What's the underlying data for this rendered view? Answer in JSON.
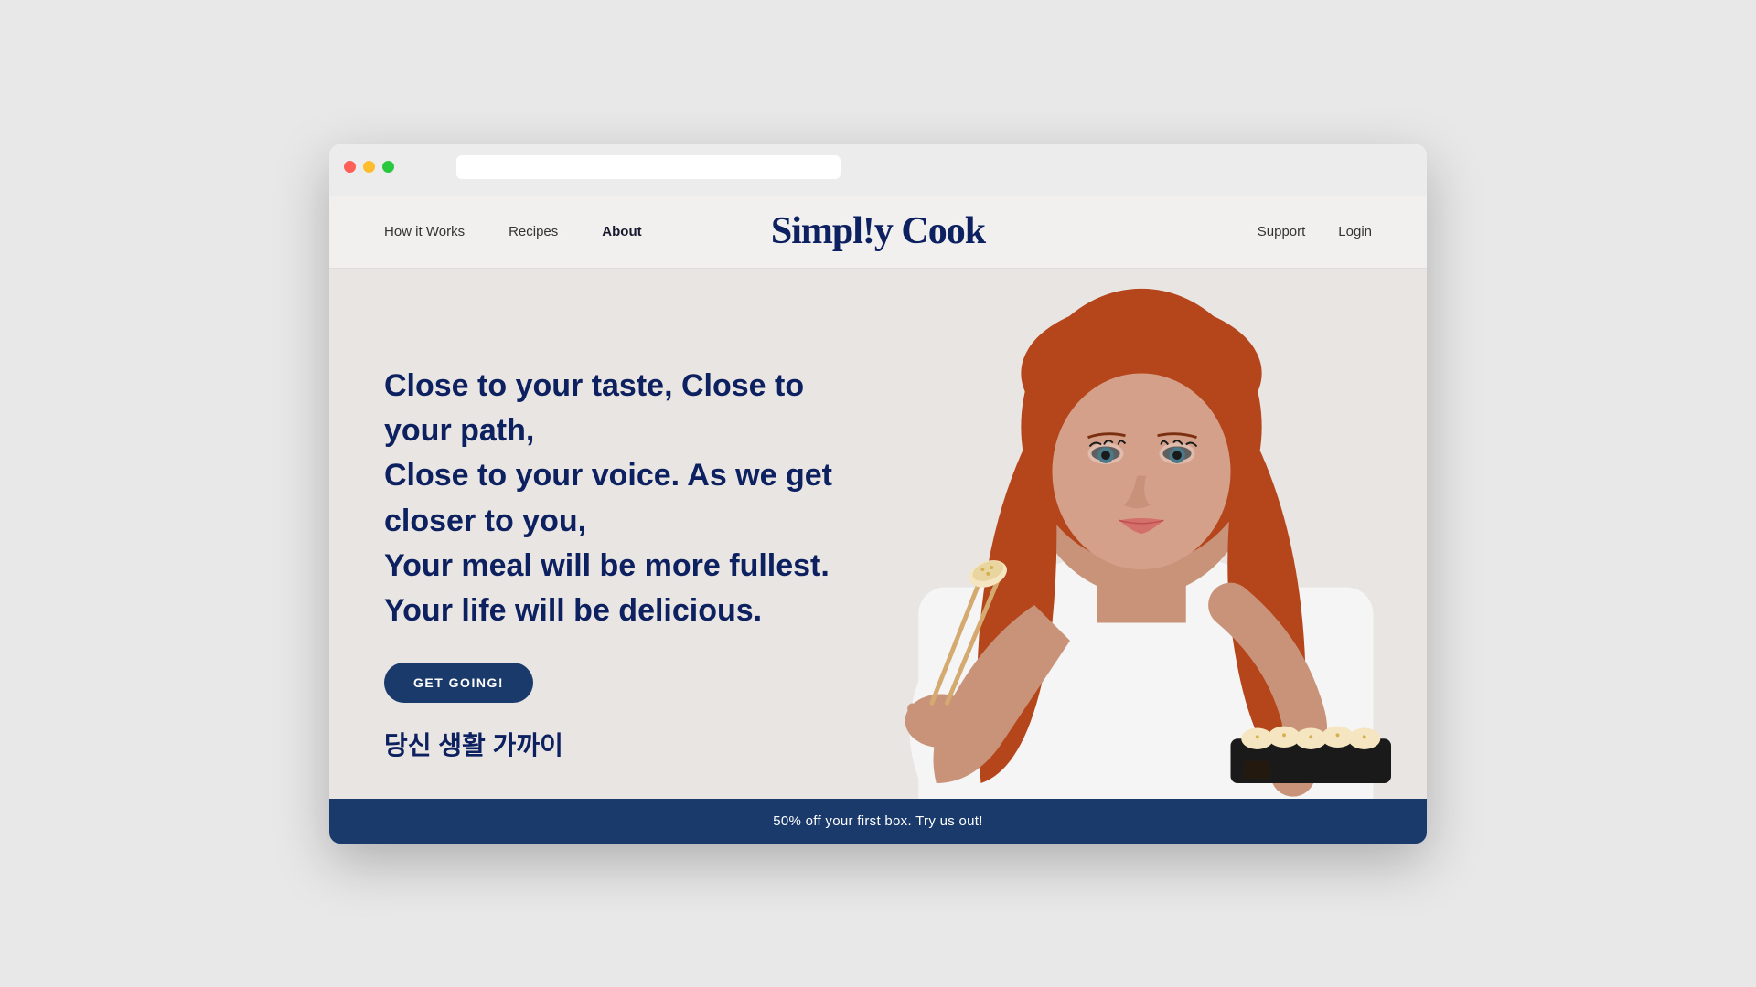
{
  "browser": {
    "dots": [
      "red",
      "yellow",
      "green"
    ]
  },
  "navbar": {
    "logo": "Simpl!y Cook",
    "nav_left": [
      {
        "label": "How it Works",
        "active": false
      },
      {
        "label": "Recipes",
        "active": false
      },
      {
        "label": "About",
        "active": true
      }
    ],
    "nav_right": [
      {
        "label": "Support",
        "active": false
      },
      {
        "label": "Login",
        "active": false
      }
    ]
  },
  "hero": {
    "headline": "Close to your taste, Close to your path,\nClose to your voice. As we get closer to you,\nYour meal will be more fullest.\nYour life will be delicious.",
    "cta_label": "GET GOING!",
    "korean_text": "당신 생활 가까이"
  },
  "promo_banner": {
    "text": "50% off your first box. Try us out!"
  }
}
